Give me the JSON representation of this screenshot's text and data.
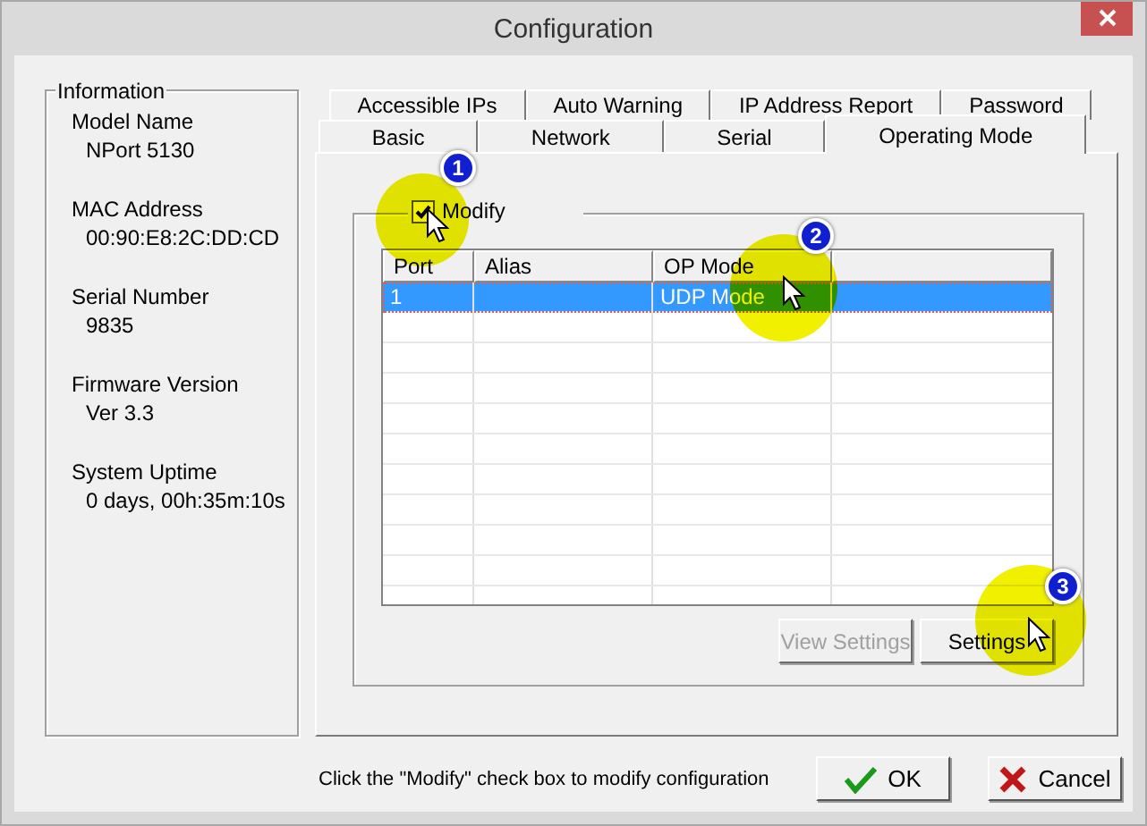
{
  "window": {
    "title": "Configuration"
  },
  "information": {
    "title": "Information",
    "fields": [
      {
        "label": "Model Name",
        "value": "NPort 5130"
      },
      {
        "label": "MAC Address",
        "value": "00:90:E8:2C:DD:CD"
      },
      {
        "label": "Serial Number",
        "value": "9835"
      },
      {
        "label": "Firmware Version",
        "value": "Ver 3.3"
      },
      {
        "label": "System Uptime",
        "value": "0 days, 00h:35m:10s"
      }
    ]
  },
  "tab_rows": [
    {
      "tabs": [
        {
          "label": "Accessible IPs",
          "selected": false
        },
        {
          "label": "Auto Warning",
          "selected": false
        },
        {
          "label": "IP Address Report",
          "selected": false
        },
        {
          "label": "Password",
          "selected": false
        }
      ]
    },
    {
      "tabs": [
        {
          "label": "Basic",
          "selected": false
        },
        {
          "label": "Network",
          "selected": false
        },
        {
          "label": "Serial",
          "selected": false
        },
        {
          "label": "Operating Mode",
          "selected": true
        }
      ]
    }
  ],
  "modify": {
    "label": "Modify",
    "checked": true
  },
  "table": {
    "columns": [
      "Port",
      "Alias",
      "OP Mode"
    ],
    "rows": [
      {
        "cells": [
          "1",
          null,
          "UDP Mode"
        ],
        "selected": true
      }
    ]
  },
  "panel_buttons": [
    {
      "label": "View Settings",
      "disabled": true
    },
    {
      "label": "Settings",
      "disabled": false
    }
  ],
  "hint": "Click the \"Modify\" check box to modify configuration",
  "dialog_buttons": [
    {
      "label": "OK",
      "kind": "ok"
    },
    {
      "label": "Cancel",
      "kind": "cancel"
    }
  ],
  "annotations": [
    {
      "number": "1"
    },
    {
      "number": "2"
    },
    {
      "number": "3"
    }
  ]
}
